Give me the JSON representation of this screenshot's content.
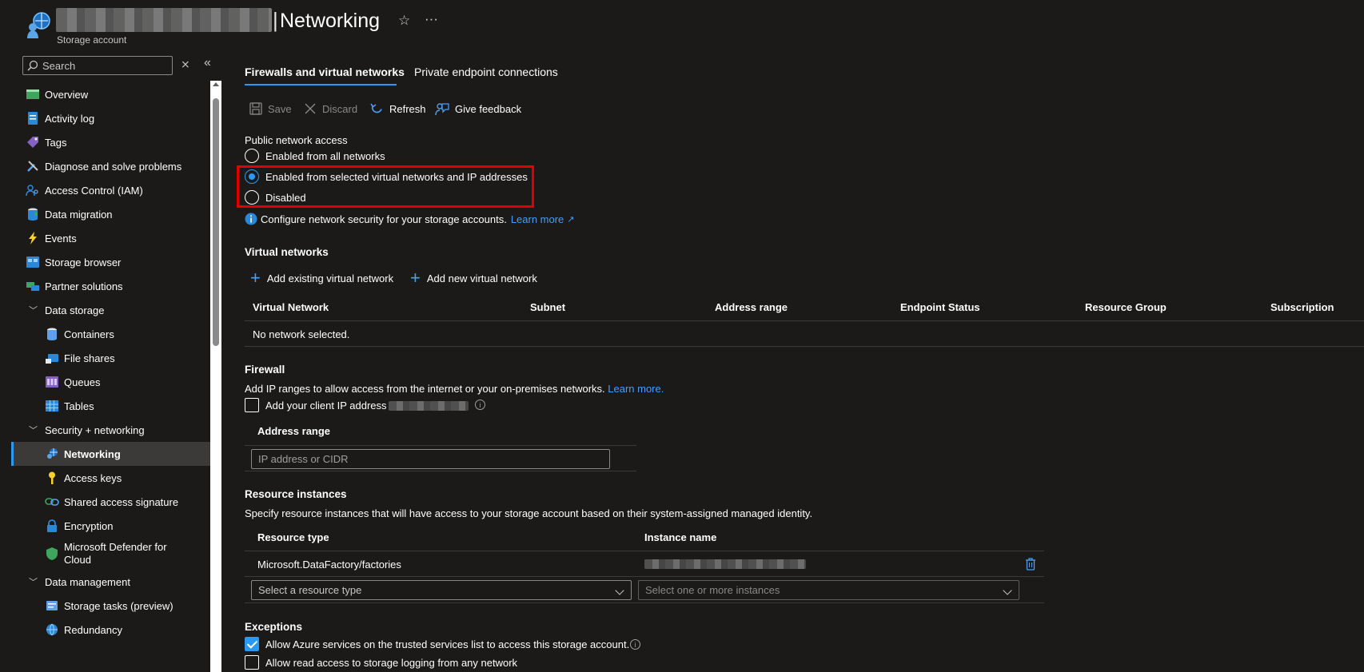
{
  "header": {
    "title": "Networking",
    "subtitle": "Storage account"
  },
  "search": {
    "placeholder": "Search"
  },
  "sidebar": {
    "items": [
      {
        "label": "Overview"
      },
      {
        "label": "Activity log"
      },
      {
        "label": "Tags"
      },
      {
        "label": "Diagnose and solve problems"
      },
      {
        "label": "Access Control (IAM)"
      },
      {
        "label": "Data migration"
      },
      {
        "label": "Events"
      },
      {
        "label": "Storage browser"
      },
      {
        "label": "Partner solutions"
      }
    ],
    "groups": [
      {
        "label": "Data storage",
        "items": [
          {
            "label": "Containers"
          },
          {
            "label": "File shares"
          },
          {
            "label": "Queues"
          },
          {
            "label": "Tables"
          }
        ]
      },
      {
        "label": "Security + networking",
        "items": [
          {
            "label": "Networking"
          },
          {
            "label": "Access keys"
          },
          {
            "label": "Shared access signature"
          },
          {
            "label": "Encryption"
          },
          {
            "label": "Microsoft Defender for",
            "label2": "Cloud"
          }
        ]
      },
      {
        "label": "Data management",
        "items": [
          {
            "label": "Storage tasks (preview)"
          },
          {
            "label": "Redundancy"
          }
        ]
      }
    ]
  },
  "tabs": [
    {
      "label": "Firewalls and virtual networks"
    },
    {
      "label": "Private endpoint connections"
    }
  ],
  "toolbar": {
    "save": "Save",
    "discard": "Discard",
    "refresh": "Refresh",
    "feedback": "Give feedback"
  },
  "public_access": {
    "label": "Public network access",
    "options": [
      "Enabled from all networks",
      "Enabled from selected virtual networks and IP addresses",
      "Disabled"
    ],
    "selected": 1,
    "info": "Configure network security for your storage accounts.",
    "learn_more": "Learn more"
  },
  "virtual_networks": {
    "title": "Virtual networks",
    "add_existing": "Add existing virtual network",
    "add_new": "Add new virtual network",
    "columns": [
      "Virtual Network",
      "Subnet",
      "Address range",
      "Endpoint Status",
      "Resource Group",
      "Subscription"
    ],
    "empty": "No network selected."
  },
  "firewall": {
    "title": "Firewall",
    "description": "Add IP ranges to allow access from the internet or your on-premises networks.",
    "learn_more": "Learn more.",
    "client_ip_label": "Add your client IP address",
    "address_range_header": "Address range",
    "address_placeholder": "IP address or CIDR"
  },
  "resource_instances": {
    "title": "Resource instances",
    "description": "Specify resource instances that will have access to your storage account based on their system-assigned managed identity.",
    "col_type": "Resource type",
    "col_name": "Instance name",
    "row_type": "Microsoft.DataFactory/factories",
    "select_type": "Select a resource type",
    "select_instances": "Select one or more instances"
  },
  "exceptions": {
    "title": "Exceptions",
    "items": [
      {
        "label": "Allow Azure services on the trusted services list to access this storage account.",
        "checked": true
      },
      {
        "label": "Allow read access to storage logging from any network",
        "checked": false
      }
    ]
  }
}
